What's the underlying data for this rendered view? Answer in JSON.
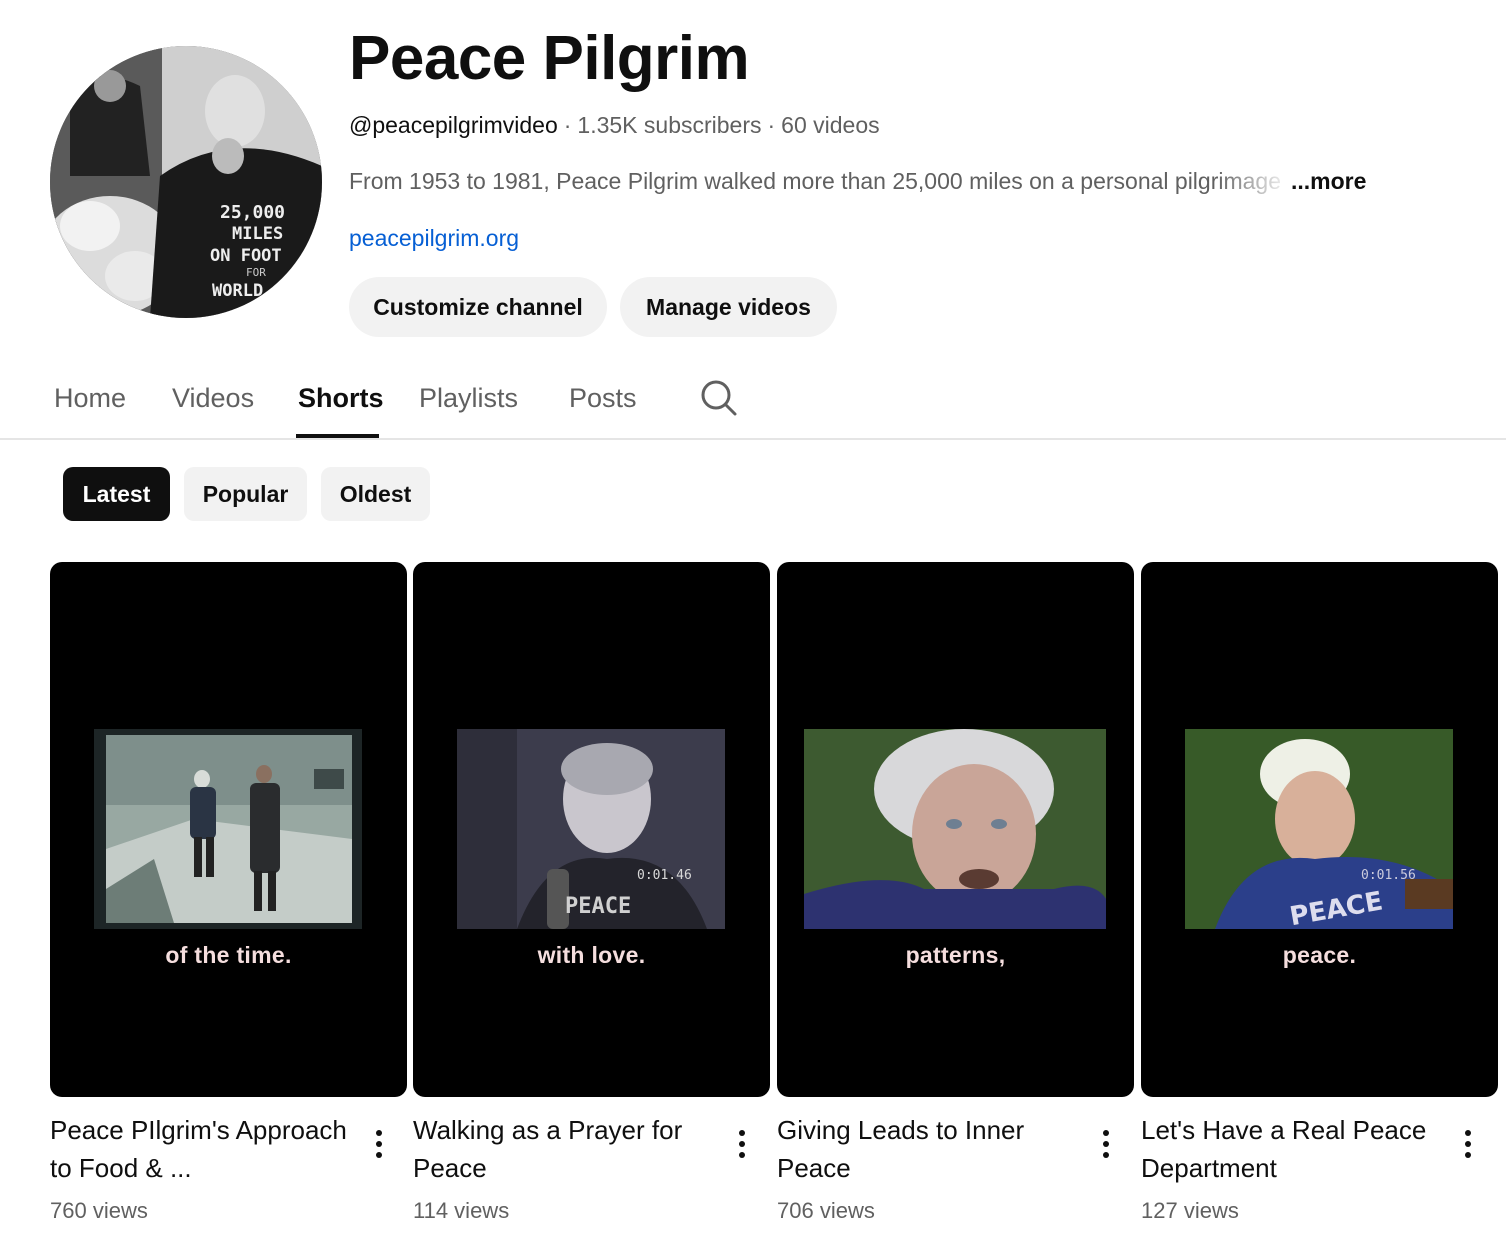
{
  "channel": {
    "name": "Peace Pilgrim",
    "handle": "@peacepilgrimvideo",
    "subscribers": "1.35K subscribers",
    "videos": "60 videos",
    "separator": "·",
    "description": "From 1953 to 1981, Peace Pilgrim walked more than 25,000 miles on a personal pilgrimage",
    "more_label": "...more",
    "link": "peacepilgrim.org",
    "avatar_jacket_text": [
      "25,000",
      "MILES",
      "ON FOOT",
      "FOR",
      "WORLD"
    ]
  },
  "actions": {
    "customize": "Customize channel",
    "manage": "Manage videos"
  },
  "tabs": [
    {
      "label": "Home",
      "active": false
    },
    {
      "label": "Videos",
      "active": false
    },
    {
      "label": "Shorts",
      "active": true
    },
    {
      "label": "Playlists",
      "active": false
    },
    {
      "label": "Posts",
      "active": false
    }
  ],
  "chips": [
    {
      "label": "Latest",
      "active": true
    },
    {
      "label": "Popular",
      "active": false
    },
    {
      "label": "Oldest",
      "active": false
    }
  ],
  "shorts": [
    {
      "title": "Peace PIlgrim's Approach to Food & ...",
      "views": "760 views",
      "caption": "of the time.",
      "timestamp": ""
    },
    {
      "title": "Walking as a Prayer for Peace",
      "views": "114 views",
      "caption": "with love.",
      "timestamp": "0:01.46",
      "shirt_text": "PEACE"
    },
    {
      "title": "Giving Leads to Inner Peace",
      "views": "706 views",
      "caption": "patterns,",
      "timestamp": ""
    },
    {
      "title": "Let's Have a Real Peace Department",
      "views": "127 views",
      "caption": "peace.",
      "timestamp": "0:01.56",
      "shirt_text": "PEACE"
    }
  ],
  "colors": {
    "link": "#065fd4",
    "text": "#0f0f0f",
    "secondary": "#606060",
    "chip_bg": "#f2f2f2"
  }
}
